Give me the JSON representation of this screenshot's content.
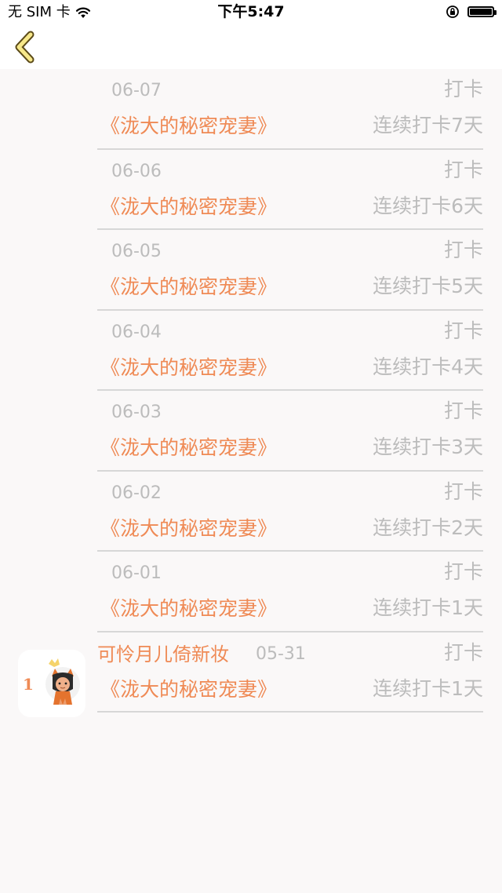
{
  "status_bar": {
    "carrier": "无 SIM 卡",
    "time": "下午5:47",
    "battery_level": 1.0
  },
  "nav": {
    "back_icon": "chevron-left-icon"
  },
  "colors": {
    "accent": "#ef8a55",
    "muted": "#bcbcbc",
    "divider": "#d7d7d7",
    "background": "#faf8f8",
    "back_icon_fill": "#f7e88a",
    "back_icon_stroke": "#5b4a18"
  },
  "entries": [
    {
      "date": "06-07",
      "checkin_label": "打卡",
      "book_title": "《泷大的秘密宠妻》",
      "streak": "连续打卡7天"
    },
    {
      "date": "06-06",
      "checkin_label": "打卡",
      "book_title": "《泷大的秘密宠妻》",
      "streak": "连续打卡6天"
    },
    {
      "date": "06-05",
      "checkin_label": "打卡",
      "book_title": "《泷大的秘密宠妻》",
      "streak": "连续打卡5天"
    },
    {
      "date": "06-04",
      "checkin_label": "打卡",
      "book_title": "《泷大的秘密宠妻》",
      "streak": "连续打卡4天"
    },
    {
      "date": "06-03",
      "checkin_label": "打卡",
      "book_title": "《泷大的秘密宠妻》",
      "streak": "连续打卡3天"
    },
    {
      "date": "06-02",
      "checkin_label": "打卡",
      "book_title": "《泷大的秘密宠妻》",
      "streak": "连续打卡2天"
    },
    {
      "date": "06-01",
      "checkin_label": "打卡",
      "book_title": "《泷大的秘密宠妻》",
      "streak": "连续打卡1天"
    }
  ],
  "first_entry": {
    "rank": "1",
    "avatar_icon": "fox-girl-avatar-icon",
    "username": "可怜月儿倚新妆",
    "date": "05-31",
    "checkin_label": "打卡",
    "book_title": "《泷大的秘密宠妻》",
    "streak": "连续打卡1天"
  }
}
